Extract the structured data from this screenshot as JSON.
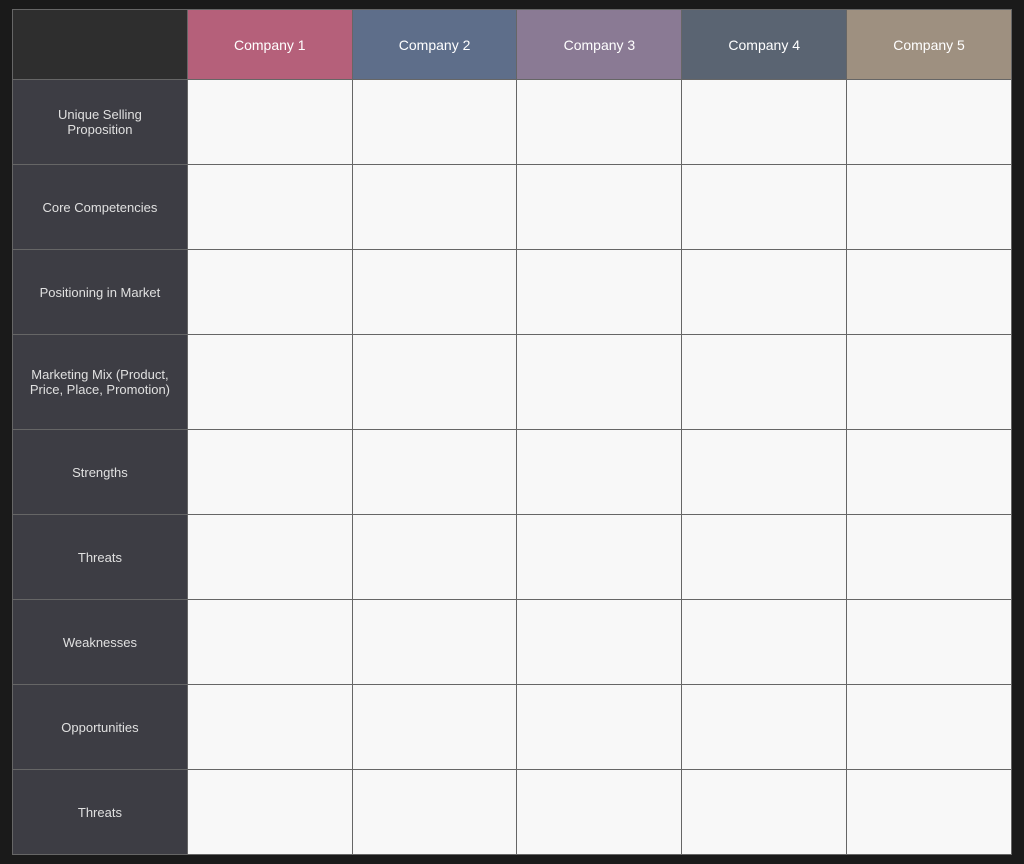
{
  "header": {
    "empty_label": "",
    "companies": [
      {
        "label": "Company 1",
        "class": "th-company1"
      },
      {
        "label": "Company 2",
        "class": "th-company2"
      },
      {
        "label": "Company 3",
        "class": "th-company3"
      },
      {
        "label": "Company 4",
        "class": "th-company4"
      },
      {
        "label": "Company 5",
        "class": "th-company5"
      }
    ]
  },
  "rows": [
    {
      "label": "Unique Selling Proposition"
    },
    {
      "label": "Core Competencies"
    },
    {
      "label": "Positioning in Market"
    },
    {
      "label": "Marketing Mix (Product, Price, Place, Promotion)"
    },
    {
      "label": "Strengths"
    },
    {
      "label": "Threats"
    },
    {
      "label": "Weaknesses"
    },
    {
      "label": "Opportunities"
    },
    {
      "label": "Threats"
    }
  ]
}
